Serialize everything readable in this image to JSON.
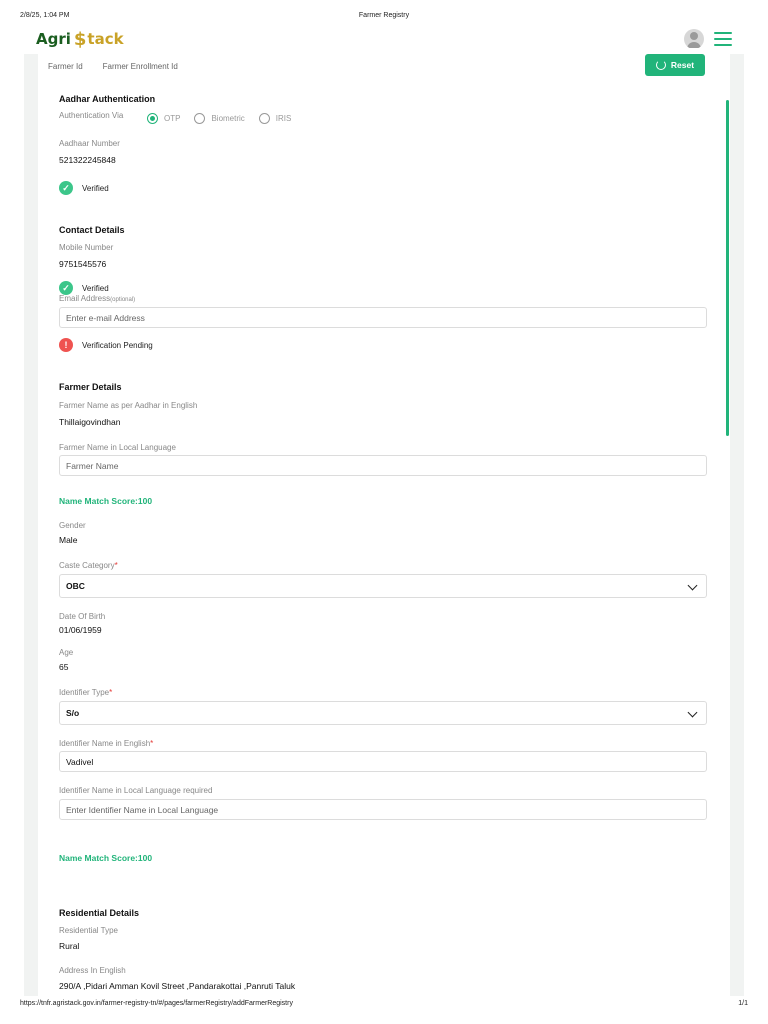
{
  "print": {
    "datetime": "2/8/25, 1:04 PM",
    "page_title": "Farmer Registry",
    "url": "https://tnfr.agristack.gov.in/farmer-registry-tn/#/pages/farmerRegistry/addFarmerRegistry",
    "page_count": "1/1"
  },
  "header": {
    "logo_part1": "Agri",
    "logo_mark": "$",
    "logo_part2": "tack",
    "avatar_icon": "user-avatar-icon",
    "menu_icon": "hamburger-menu-icon"
  },
  "top": {
    "farmer_id_label": "Farmer Id",
    "enrollment_id_label": "Farmer Enrollment Id",
    "reset_label": "Reset"
  },
  "aadhar": {
    "title": "Aadhar Authentication",
    "auth_via_label": "Authentication Via",
    "options": [
      "OTP",
      "Biometric",
      "IRIS"
    ],
    "selected": "OTP",
    "number_label": "Aadhaar Number",
    "number_value": "521322245848",
    "status": "Verified"
  },
  "contact": {
    "title": "Contact Details",
    "mobile_label": "Mobile Number",
    "mobile_value": "9751545576",
    "mobile_status": "Verified",
    "email_label": "Email Address",
    "email_optional": "(optional)",
    "email_placeholder": "Enter e-mail Address",
    "email_status": "Verification Pending"
  },
  "farmer": {
    "title": "Farmer Details",
    "name_en_label": "Farmer Name as per Aadhar in English",
    "name_en_value": "Thillaigovindhan",
    "name_local_label": "Farmer Name in Local Language",
    "name_local_placeholder": "Farmer Name",
    "match_score_1": "Name Match Score:100",
    "gender_label": "Gender",
    "gender_value": "Male",
    "caste_label": "Caste Category",
    "caste_value": "OBC",
    "dob_label": "Date Of Birth",
    "dob_value": "01/06/1959",
    "age_label": "Age",
    "age_value": "65",
    "identifier_type_label": "Identifier Type",
    "identifier_type_value": "S/o",
    "identifier_name_en_label": "Identifier Name in English",
    "identifier_name_en_value": "Vadivel",
    "identifier_name_local_label": "Identifier Name in Local Language required",
    "identifier_name_local_placeholder": "Enter Identifier Name in Local Language",
    "match_score_2": "Name Match Score:100",
    "required_mark": "*"
  },
  "residential": {
    "title": "Residential Details",
    "type_label": "Residential Type",
    "type_value": "Rural",
    "address_label": "Address In English",
    "address_value": "290/A ,Pidari Amman Kovil Street ,Pandarakottai ,Panruti Taluk"
  },
  "colors": {
    "accent": "#21b47a",
    "error": "#e53935"
  }
}
